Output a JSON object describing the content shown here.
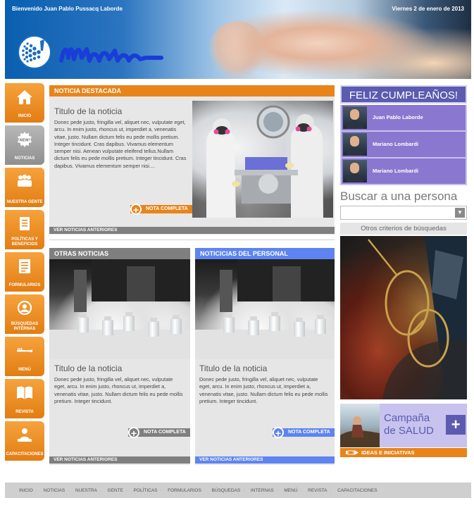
{
  "header": {
    "greeting": "Bienvenido Juan Pablo Pussacq Laborde",
    "date": "Viernes 2 de enero de 2013"
  },
  "sidebar": {
    "items": [
      {
        "label": "INICIO",
        "icon": "home-icon",
        "active": false
      },
      {
        "label": "NOTICIAS",
        "icon": "news-badge-icon",
        "active": true
      },
      {
        "label": "NUESTRA GENTE",
        "icon": "people-icon",
        "active": false
      },
      {
        "label": "POLÍTICAS Y BENEFICIOS",
        "icon": "document-icon",
        "active": false
      },
      {
        "label": "FORMULARIOS",
        "icon": "form-icon",
        "active": false
      },
      {
        "label": "BÚSQUEDAS INTERNAS",
        "icon": "search-person-icon",
        "active": false
      },
      {
        "label": "MENÚ",
        "icon": "cutlery-icon",
        "active": false
      },
      {
        "label": "REVISTA",
        "icon": "book-icon",
        "active": false
      },
      {
        "label": "CAPACITACIONES",
        "icon": "training-icon",
        "active": false
      }
    ],
    "new_badge": "NEW!"
  },
  "featured": {
    "section_label": "NOTICIA DESTACADA",
    "title": "Titulo de la noticia",
    "body": "Donec pede justo, fringilla vel, aliquet nec, vulputate eget, arcu. In enim justo, rhoncus ut, imperdiet a, venenatis vitae, justo. Nullam dictum felis eu pede mollis pretium. Integer tincidunt. Cras dapibus. Vivamus elementum semper nisi. Aenean vulputate eleifend tellus.Nullam dictum felis eu pede mollis pretium. Integer tincidunt. Cras dapibus. Vivamus elementum semper nisi....",
    "more_label": "NOTA COMPLETA",
    "previous_label": "VER NOTICIAS ANTERIORES"
  },
  "other_news": {
    "section_label": "OTRAS NOTICIAS",
    "title": "Titulo de la noticia",
    "body": "Donec pede justo, fringilla vel, aliquet nec, vulputate eget, arcu. In enim justo, rhoncus ut, imperdiet a, venenatis vitae, justo. Nullam dictum felis eu pede mollis pretium. Integer tincidunt.",
    "more_label": "NOTA COMPLETA",
    "previous_label": "VER NOTICIAS ANTERIORES"
  },
  "staff_news": {
    "section_label": "NOTICICIAS DEL PERSONAL",
    "title": "Titulo de la noticia",
    "body": "Donec pede justo, fringilla vel, aliquet nec, vulputate eget, arcu. In enim justo, rhoncus ut, imperdiet a, venenatis vitae, justo. Nullam dictum felis eu pede mollis pretium. Integer tincidunt.",
    "more_label": "NOTA COMPLETA",
    "previous_label": "VER NOTICIAS ANTERIORES"
  },
  "birthday": {
    "title": "FELIZ CUMPLEAÑOS!",
    "people": [
      "Juan Pablo Laborde",
      "Mariano Lombardi",
      "Mariano Lombardi"
    ]
  },
  "search": {
    "title": "Buscar a una persona",
    "value": "",
    "criteria_label": "Otros criterios de búsquedas"
  },
  "campaign": {
    "line1": "Campaña",
    "line2": "de SALUD",
    "footer_label": "IDEAS E INICIATIVAS"
  },
  "footer": {
    "links": [
      "INICIO",
      "NOTICIAS",
      "NUESTRA",
      "GENTE",
      "POLÍTICAS",
      "FORMULARIOS",
      "BÚSQUEDAS",
      "INTERNAS",
      "MENÚ",
      "REVISTA",
      "CAPACITACIONES"
    ]
  },
  "colors": {
    "orange": "#e8841a",
    "gray": "#7f7f7f",
    "blue": "#5d84f0",
    "purple": "#8a78d0",
    "birthday_header": "#5b5bb0"
  }
}
